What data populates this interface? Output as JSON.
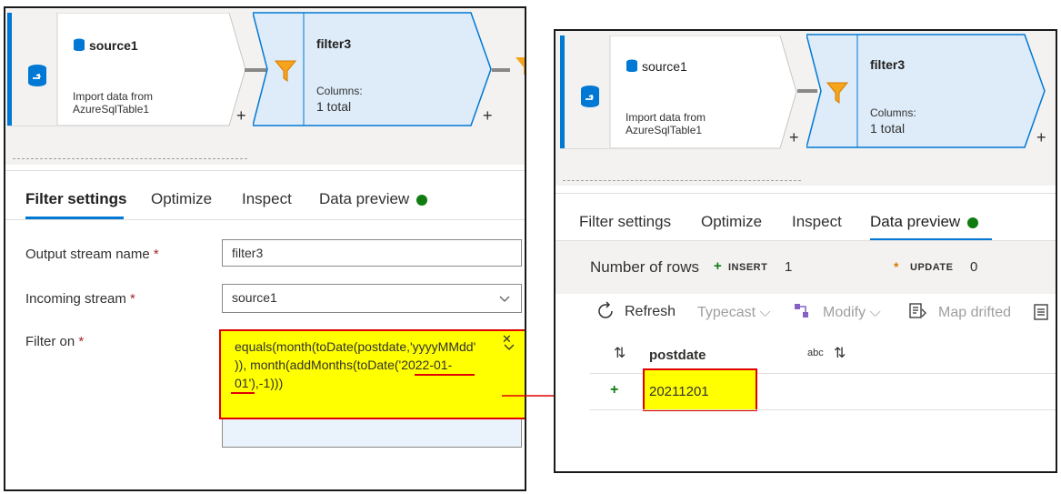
{
  "left": {
    "source_node": {
      "name": "source1",
      "desc_line1": "Import data from",
      "desc_line2": "AzureSqlTable1",
      "add": "+"
    },
    "filter_node": {
      "name": "filter3",
      "columns_label": "Columns:",
      "columns_value": "1 total",
      "add": "+"
    },
    "tabs": [
      {
        "label": "Filter settings",
        "active": true
      },
      {
        "label": "Optimize",
        "active": false
      },
      {
        "label": "Inspect",
        "active": false
      },
      {
        "label": "Data preview",
        "active": false
      }
    ],
    "form": {
      "output_stream_label": "Output stream name",
      "output_stream_value": "filter3",
      "incoming_stream_label": "Incoming stream",
      "incoming_stream_value": "source1",
      "filter_on_label": "Filter on",
      "required_mark": "*",
      "expression_line1": "equals(month(toDate(postdate,'yyyyMMdd'",
      "expression_line2": ")), month(addMonths(toDate('2022-01-",
      "expression_line3": "01'),-1)))"
    }
  },
  "right": {
    "source_node": {
      "name": "source1",
      "desc_line1": "Import data from",
      "desc_line2": "AzureSqlTable1",
      "add": "+"
    },
    "filter_node": {
      "name": "filter3",
      "columns_label": "Columns:",
      "columns_value": "1 total",
      "add": "+"
    },
    "tabs": [
      {
        "label": "Filter settings",
        "active": false
      },
      {
        "label": "Optimize",
        "active": false
      },
      {
        "label": "Inspect",
        "active": false
      },
      {
        "label": "Data preview",
        "active": true
      }
    ],
    "rows_summary": {
      "label": "Number of rows",
      "insert_label": "INSERT",
      "insert_value": "1",
      "update_label": "UPDATE",
      "update_value": "0"
    },
    "toolbar": {
      "refresh": "Refresh",
      "typecast": "Typecast",
      "modify": "Modify",
      "map_drifted": "Map drifted"
    },
    "table": {
      "column": "postdate",
      "column_type": "abc",
      "rows": [
        "20211201"
      ]
    }
  },
  "colors": {
    "accent": "#0078d4",
    "highlight": "#ffff00",
    "annotation": "#e00000",
    "status_green": "#107c10"
  }
}
